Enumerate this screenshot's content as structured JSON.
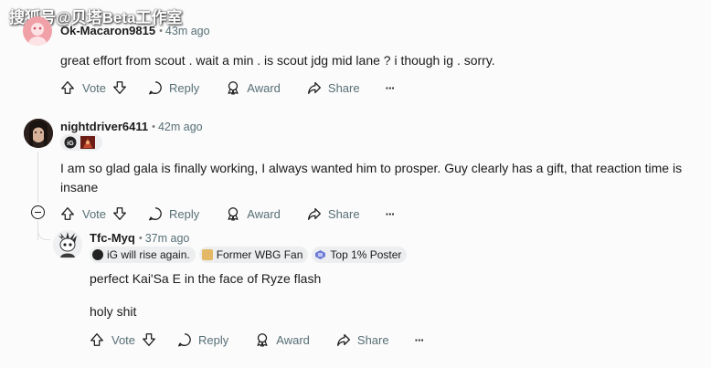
{
  "watermark": "搜狐号@贝塔Beta工作室",
  "actions": {
    "vote": "Vote",
    "reply": "Reply",
    "award": "Award",
    "share": "Share",
    "more": "···"
  },
  "comments": [
    {
      "username": "Ok-Macaron9815",
      "time": "43m ago",
      "body": "great effort from scout . wait a min . is scout jdg mid lane ? i though ig . sorry."
    },
    {
      "username": "nightdriver6411",
      "time": "42m ago",
      "body": "I am so glad gala is finally working, I always wanted him to prosper. Guy clearly has a gift, that reaction time is insane"
    },
    {
      "username": "Tfc-Myq",
      "time": "37m ago",
      "flairs": [
        "iG will rise again.",
        "Former WBG Fan",
        "Top 1% Poster"
      ],
      "body_lines": [
        "perfect Kai'Sa E in the face of Ryze flash",
        "holy shit"
      ]
    }
  ],
  "colors": {
    "background": "#fbfbfb",
    "meta": "#576f76",
    "thread_line": "#dcdfe2",
    "avatar_pink": "#f0a1a8"
  }
}
